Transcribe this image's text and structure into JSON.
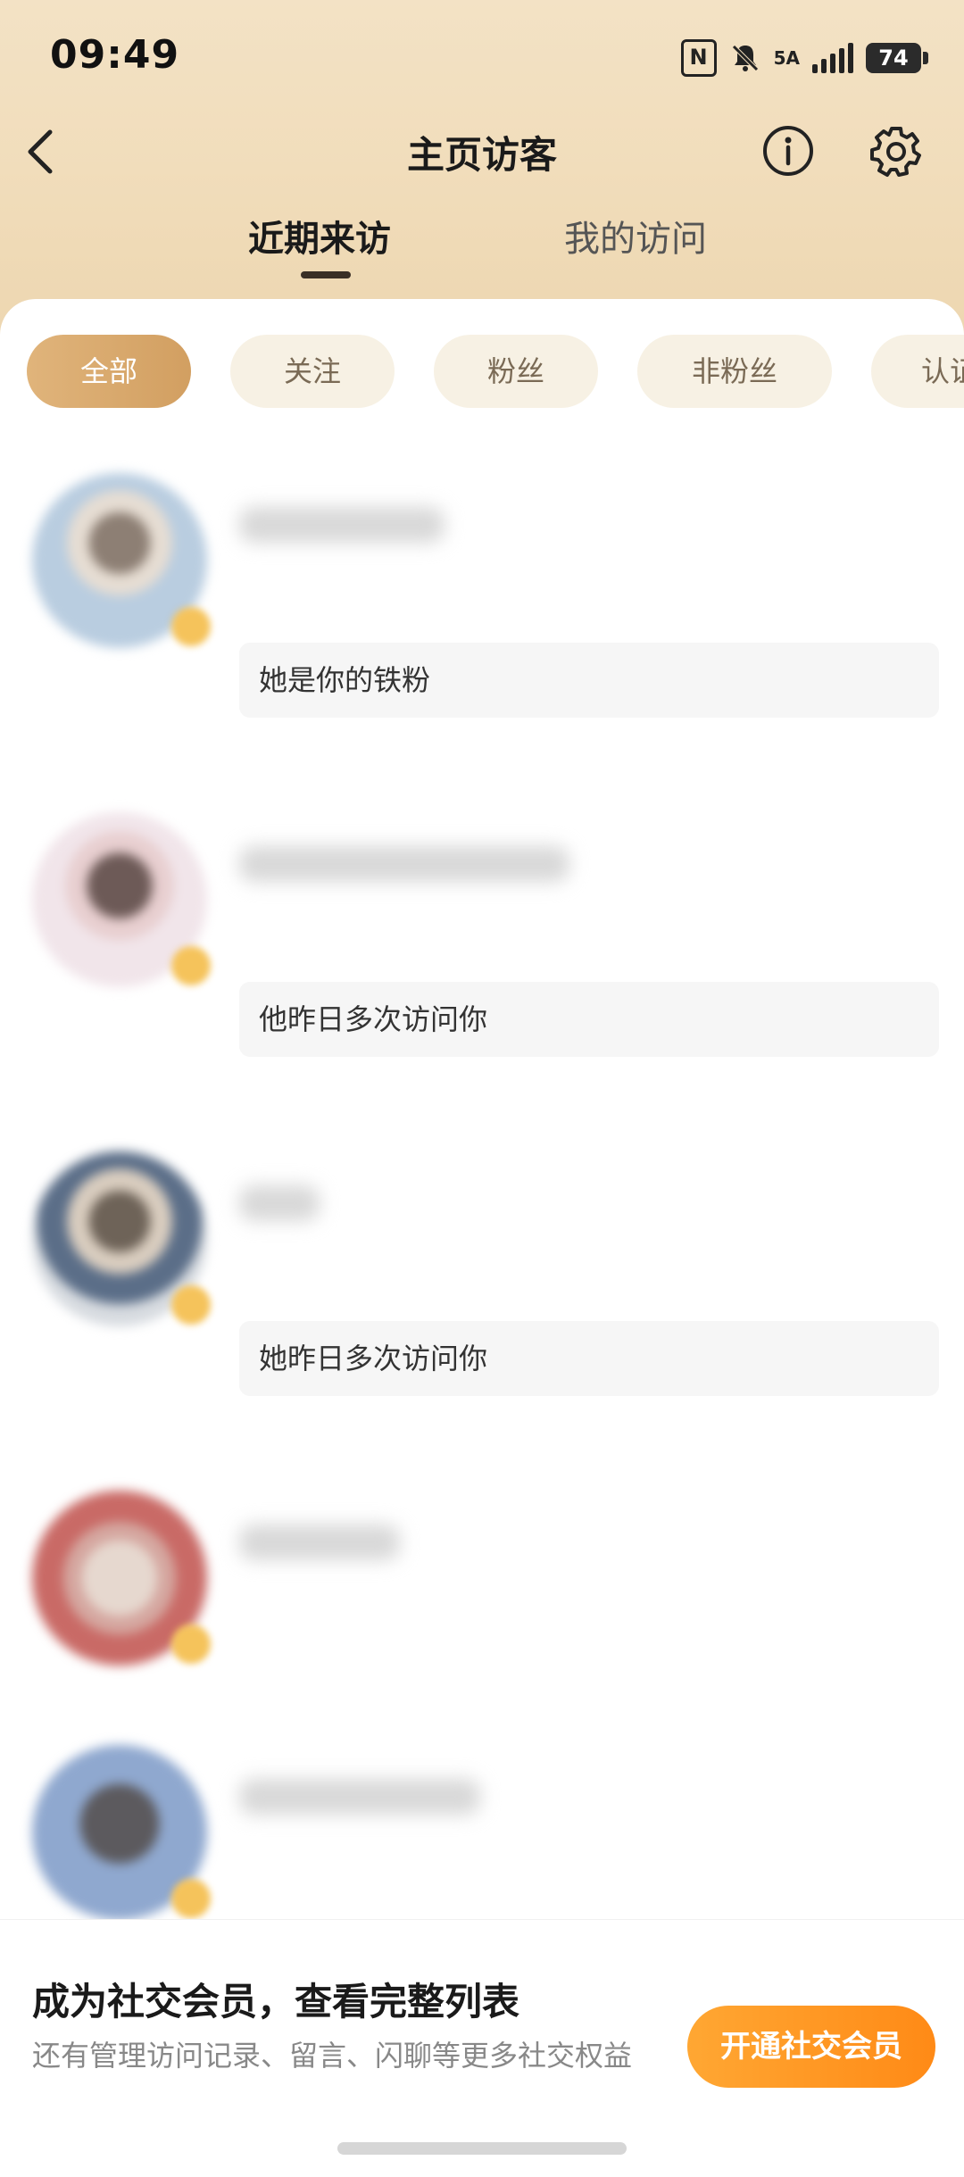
{
  "status_bar": {
    "time": "09:49",
    "network": "5A",
    "battery": "74"
  },
  "header": {
    "title": "主页访客"
  },
  "tabs": [
    {
      "label": "近期来访",
      "active": true
    },
    {
      "label": "我的访问",
      "active": false
    }
  ],
  "filters": [
    {
      "label": "全部",
      "active": true
    },
    {
      "label": "关注",
      "active": false
    },
    {
      "label": "粉丝",
      "active": false
    },
    {
      "label": "非粉丝",
      "active": false
    },
    {
      "label": "认证",
      "active": false
    }
  ],
  "visitors": [
    {
      "note": "她是你的铁粉",
      "avatar_color": "#c9d9e8"
    },
    {
      "note": "他昨日多次访问你",
      "avatar_color": "#e9d9e0"
    },
    {
      "note": "她昨日多次访问你",
      "avatar_color": "#c8cdd6"
    },
    {
      "note": "",
      "avatar_color": "#c96a66"
    },
    {
      "note": "",
      "avatar_color": "#8fb1e0"
    }
  ],
  "promo": {
    "title": "成为社交会员，查看完整列表",
    "description": "还有管理访问记录、留言、闪聊等更多社交权益",
    "button": "开通社交会员"
  },
  "colors": {
    "accent": "#d9a86a",
    "button": "#ff9a20",
    "header_bg": "#f1ddbb"
  }
}
